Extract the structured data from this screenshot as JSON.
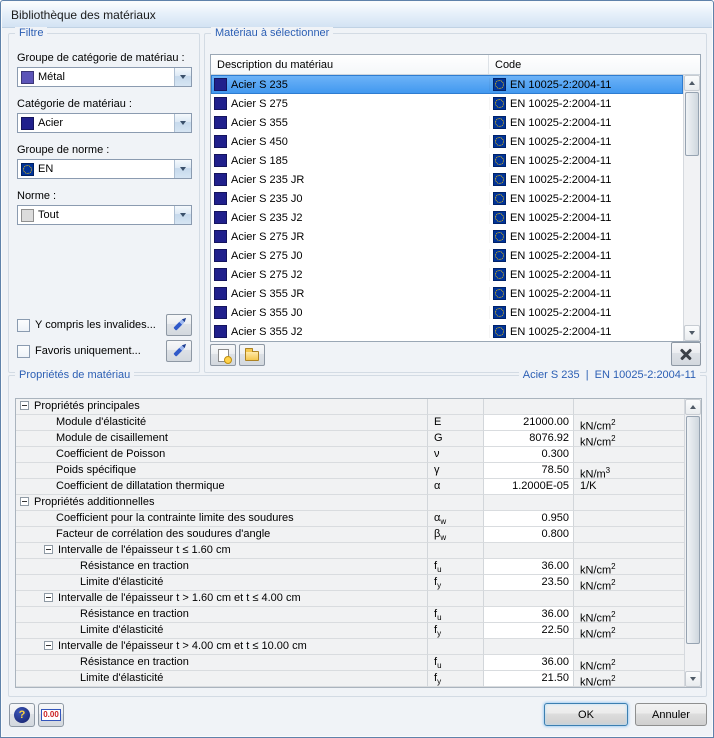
{
  "window": {
    "title": "Bibliothèque des matériaux"
  },
  "colors": {
    "caption_blue": "#2c5fb4",
    "selection_blue": "#4f9ff3",
    "eu_flag_blue": "#003399",
    "steel_swatch": "#20208c",
    "dialog_background": "#f0f3f7"
  },
  "icons": {
    "chevron_down": "chevron-down",
    "pencil": "edit-pencil",
    "new_document": "new-document",
    "open_folder": "open-folder",
    "delete_x": "delete-x",
    "eu_flag": "eu-flag",
    "help_glyph": "?",
    "calc_glyph": "0.00"
  },
  "filter": {
    "title": "Filtre",
    "fields": [
      {
        "label": "Groupe de catégorie de matériau :",
        "value": "Métal",
        "icon": "metal"
      },
      {
        "label": "Catégorie de matériau :",
        "value": "Acier",
        "icon": "steel"
      },
      {
        "label": "Groupe de norme :",
        "value": "EN",
        "icon": "eu"
      },
      {
        "label": "Norme :",
        "value": "Tout",
        "icon": "all"
      }
    ],
    "checkboxes": [
      {
        "label": "Y compris les invalides...",
        "checked": false
      },
      {
        "label": "Favoris uniquement...",
        "checked": false
      }
    ]
  },
  "materials": {
    "title": "Matériau à sélectionner",
    "columns": {
      "description": "Description du matériau",
      "code": "Code"
    },
    "rows": [
      {
        "name": "Acier S 235",
        "code": "EN 10025-2:2004-11",
        "selected": true
      },
      {
        "name": "Acier S 275",
        "code": "EN 10025-2:2004-11",
        "selected": false
      },
      {
        "name": "Acier S 355",
        "code": "EN 10025-2:2004-11",
        "selected": false
      },
      {
        "name": "Acier S 450",
        "code": "EN 10025-2:2004-11",
        "selected": false
      },
      {
        "name": "Acier S 185",
        "code": "EN 10025-2:2004-11",
        "selected": false
      },
      {
        "name": "Acier S 235 JR",
        "code": "EN 10025-2:2004-11",
        "selected": false
      },
      {
        "name": "Acier S 235 J0",
        "code": "EN 10025-2:2004-11",
        "selected": false
      },
      {
        "name": "Acier S 235 J2",
        "code": "EN 10025-2:2004-11",
        "selected": false
      },
      {
        "name": "Acier S 275 JR",
        "code": "EN 10025-2:2004-11",
        "selected": false
      },
      {
        "name": "Acier S 275 J0",
        "code": "EN 10025-2:2004-11",
        "selected": false
      },
      {
        "name": "Acier S 275 J2",
        "code": "EN 10025-2:2004-11",
        "selected": false
      },
      {
        "name": "Acier S 355 JR",
        "code": "EN 10025-2:2004-11",
        "selected": false
      },
      {
        "name": "Acier S 355 J0",
        "code": "EN 10025-2:2004-11",
        "selected": false
      },
      {
        "name": "Acier S 355 J2",
        "code": "EN 10025-2:2004-11",
        "selected": false
      }
    ]
  },
  "properties": {
    "title": "Propriétés de matériau",
    "context": "Acier S 235  |  EN 10025-2:2004-11",
    "rows": [
      {
        "type": "group",
        "level": 0,
        "label": "Propriétés principales",
        "symbol": "",
        "sub": "",
        "value": "",
        "unit": "",
        "unit_sup": ""
      },
      {
        "type": "item",
        "level": 1,
        "label": "Module d'élasticité",
        "symbol": "E",
        "sub": "",
        "value": "21000.00",
        "unit": "kN/cm",
        "unit_sup": "2"
      },
      {
        "type": "item",
        "level": 1,
        "label": "Module de cisaillement",
        "symbol": "G",
        "sub": "",
        "value": "8076.92",
        "unit": "kN/cm",
        "unit_sup": "2"
      },
      {
        "type": "item",
        "level": 1,
        "label": "Coefficient de Poisson",
        "symbol": "ν",
        "sub": "",
        "value": "0.300",
        "unit": "",
        "unit_sup": ""
      },
      {
        "type": "item",
        "level": 1,
        "label": "Poids spécifique",
        "symbol": "γ",
        "sub": "",
        "value": "78.50",
        "unit": "kN/m",
        "unit_sup": "3"
      },
      {
        "type": "item",
        "level": 1,
        "label": "Coefficient de dillatation thermique",
        "symbol": "α",
        "sub": "",
        "value": "1.2000E-05",
        "unit": "1/K",
        "unit_sup": ""
      },
      {
        "type": "group",
        "level": 0,
        "label": "Propriétés additionnelles",
        "symbol": "",
        "sub": "",
        "value": "",
        "unit": "",
        "unit_sup": ""
      },
      {
        "type": "item",
        "level": 1,
        "label": "Coefficient pour la contrainte limite des soudures",
        "symbol": "α",
        "sub": "w",
        "value": "0.950",
        "unit": "",
        "unit_sup": ""
      },
      {
        "type": "item",
        "level": 1,
        "label": "Facteur de corrélation des soudures d'angle",
        "symbol": "β",
        "sub": "w",
        "value": "0.800",
        "unit": "",
        "unit_sup": ""
      },
      {
        "type": "group",
        "level": 1,
        "label": "Intervalle de l'épaisseur t ≤ 1.60 cm",
        "symbol": "",
        "sub": "",
        "value": "",
        "unit": "",
        "unit_sup": ""
      },
      {
        "type": "item",
        "level": 2,
        "label": "Résistance en traction",
        "symbol": "f",
        "sub": "u",
        "value": "36.00",
        "unit": "kN/cm",
        "unit_sup": "2"
      },
      {
        "type": "item",
        "level": 2,
        "label": "Limite d'élasticité",
        "symbol": "f",
        "sub": "y",
        "value": "23.50",
        "unit": "kN/cm",
        "unit_sup": "2"
      },
      {
        "type": "group",
        "level": 1,
        "label": "Intervalle de l'épaisseur t > 1.60 cm et t ≤ 4.00 cm",
        "symbol": "",
        "sub": "",
        "value": "",
        "unit": "",
        "unit_sup": ""
      },
      {
        "type": "item",
        "level": 2,
        "label": "Résistance en traction",
        "symbol": "f",
        "sub": "u",
        "value": "36.00",
        "unit": "kN/cm",
        "unit_sup": "2"
      },
      {
        "type": "item",
        "level": 2,
        "label": "Limite d'élasticité",
        "symbol": "f",
        "sub": "y",
        "value": "22.50",
        "unit": "kN/cm",
        "unit_sup": "2"
      },
      {
        "type": "group",
        "level": 1,
        "label": "Intervalle de l'épaisseur t > 4.00 cm et t ≤ 10.00 cm",
        "symbol": "",
        "sub": "",
        "value": "",
        "unit": "",
        "unit_sup": ""
      },
      {
        "type": "item",
        "level": 2,
        "label": "Résistance en traction",
        "symbol": "f",
        "sub": "u",
        "value": "36.00",
        "unit": "kN/cm",
        "unit_sup": "2"
      },
      {
        "type": "item",
        "level": 2,
        "label": "Limite d'élasticité",
        "symbol": "f",
        "sub": "y",
        "value": "21.50",
        "unit": "kN/cm",
        "unit_sup": "2"
      }
    ]
  },
  "footer": {
    "ok": "OK",
    "cancel": "Annuler",
    "help_glyph": "?",
    "calc_label": "0.00"
  }
}
